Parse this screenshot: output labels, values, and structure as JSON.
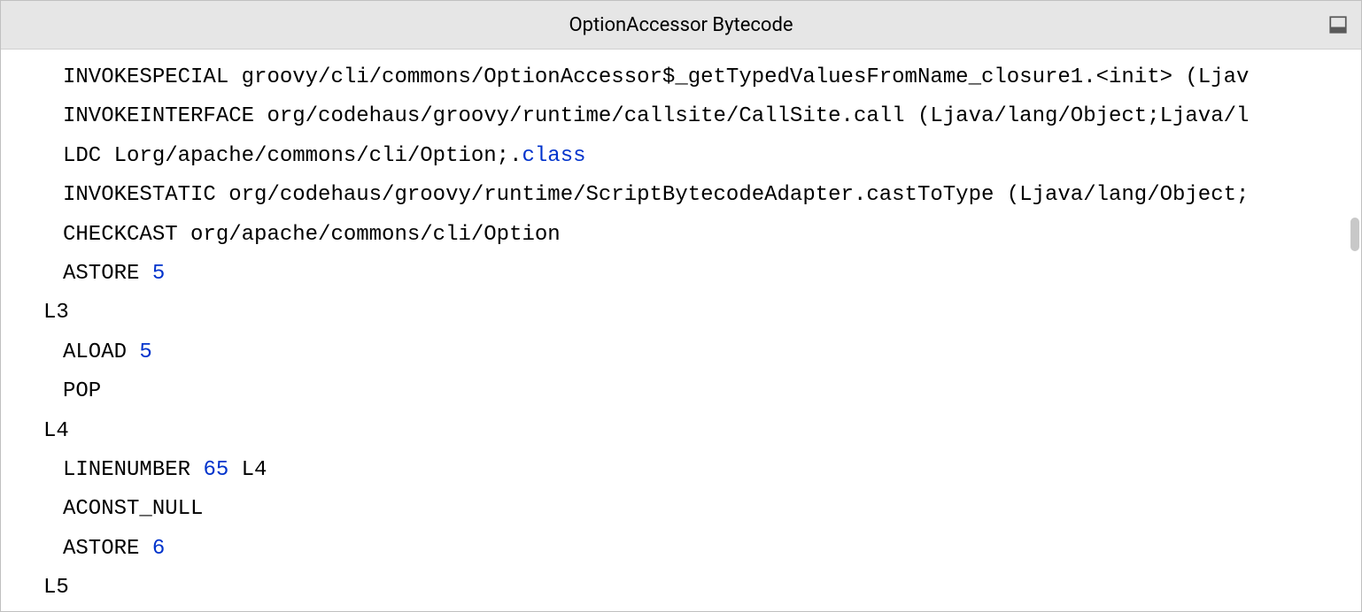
{
  "titlebar": {
    "title": "OptionAccessor Bytecode"
  },
  "code": {
    "lines": [
      {
        "indent": true,
        "tokens": [
          {
            "t": "INVOKESPECIAL groovy/cli/commons/OptionAccessor$_getTypedValuesFromName_closure1.<init> (Ljav"
          }
        ]
      },
      {
        "indent": true,
        "tokens": [
          {
            "t": "INVOKEINTERFACE org/codehaus/groovy/runtime/callsite/CallSite.call (Ljava/lang/Object;Ljava/l"
          }
        ]
      },
      {
        "indent": true,
        "tokens": [
          {
            "t": "LDC Lorg/apache/commons/cli/Option;."
          },
          {
            "t": "class",
            "cls": "kw-class"
          }
        ]
      },
      {
        "indent": true,
        "tokens": [
          {
            "t": "INVOKESTATIC org/codehaus/groovy/runtime/ScriptBytecodeAdapter.castToType (Ljava/lang/Object;"
          }
        ]
      },
      {
        "indent": true,
        "tokens": [
          {
            "t": "CHECKCAST org/apache/commons/cli/Option"
          }
        ]
      },
      {
        "indent": true,
        "tokens": [
          {
            "t": "ASTORE "
          },
          {
            "t": "5",
            "cls": "kw-number"
          }
        ]
      },
      {
        "indent": false,
        "tokens": [
          {
            "t": "L3"
          }
        ]
      },
      {
        "indent": true,
        "tokens": [
          {
            "t": "ALOAD "
          },
          {
            "t": "5",
            "cls": "kw-number"
          }
        ]
      },
      {
        "indent": true,
        "tokens": [
          {
            "t": "POP"
          }
        ]
      },
      {
        "indent": false,
        "tokens": [
          {
            "t": "L4"
          }
        ]
      },
      {
        "indent": true,
        "tokens": [
          {
            "t": "LINENUMBER "
          },
          {
            "t": "65",
            "cls": "kw-number"
          },
          {
            "t": " L4"
          }
        ]
      },
      {
        "indent": true,
        "tokens": [
          {
            "t": "ACONST_NULL"
          }
        ]
      },
      {
        "indent": true,
        "tokens": [
          {
            "t": "ASTORE "
          },
          {
            "t": "6",
            "cls": "kw-number"
          }
        ]
      },
      {
        "indent": false,
        "tokens": [
          {
            "t": "L5"
          }
        ]
      }
    ]
  }
}
